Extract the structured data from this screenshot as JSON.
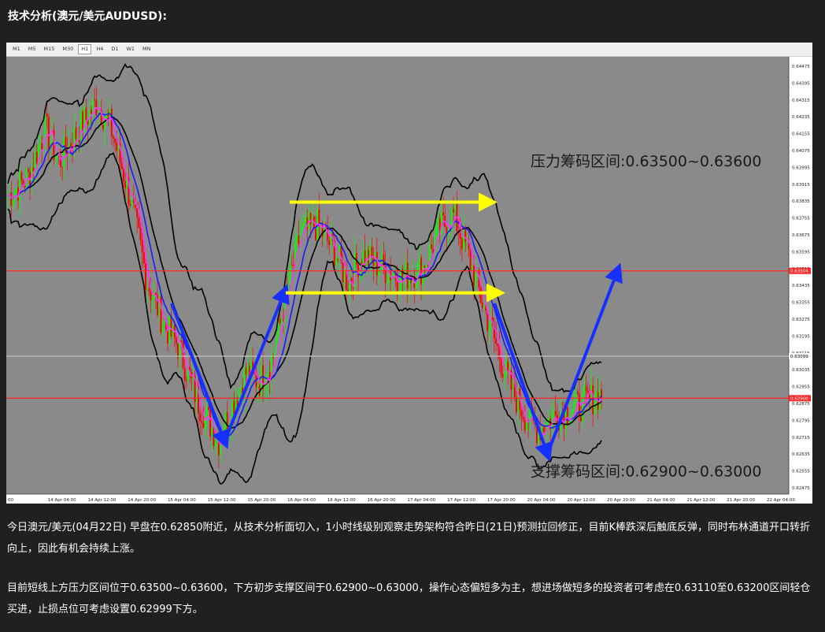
{
  "page": {
    "title": "技术分析(澳元/美元AUDUSD):"
  },
  "timeframes": [
    {
      "label": "M1",
      "active": false
    },
    {
      "label": "M5",
      "active": false
    },
    {
      "label": "M15",
      "active": false
    },
    {
      "label": "M30",
      "active": false
    },
    {
      "label": "H1",
      "active": true
    },
    {
      "label": "H4",
      "active": false
    },
    {
      "label": "D1",
      "active": false
    },
    {
      "label": "W1",
      "active": false
    },
    {
      "label": "MN",
      "active": false
    }
  ],
  "chart_data": {
    "type": "candlestick",
    "symbol": "AUDUSD",
    "timeframe": "H1",
    "ylim": [
      0.62475,
      0.64475
    ],
    "y_ticks": [
      0.64475,
      0.64395,
      0.64315,
      0.64235,
      0.64155,
      0.64075,
      0.63995,
      0.63915,
      0.63835,
      0.63755,
      0.63675,
      0.63595,
      0.63515,
      0.63435,
      0.63355,
      0.63275,
      0.63195,
      0.63115,
      0.63035,
      0.62955,
      0.62875,
      0.62795,
      0.62715,
      0.62635,
      0.62555,
      0.62475
    ],
    "x_labels": [
      "00",
      "14 Apr 04:00",
      "14 Apr 12:00",
      "14 Apr 20:00",
      "15 Apr 04:00",
      "15 Apr 12:00",
      "15 Apr 20:00",
      "16 Apr 04:00",
      "16 Apr 12:00",
      "16 Apr 20:00",
      "17 Apr 04:00",
      "17 Apr 12:00",
      "17 Apr 20:00",
      "20 Apr 04:00",
      "20 Apr 12:00",
      "20 Apr 20:00",
      "21 Apr 04:00",
      "21 Apr 12:00",
      "21 Apr 20:00",
      "22 Apr 04:00"
    ],
    "price_labels": [
      {
        "value": 0.63504,
        "color": "#ff2a2a"
      },
      {
        "value": 0.63099,
        "color": "#ffffff"
      },
      {
        "value": 0.629,
        "color": "#ff2a2a"
      }
    ],
    "horizontal_lines": [
      {
        "value": 0.63504,
        "color": "#ff2a2a"
      },
      {
        "value": 0.629,
        "color": "#ff2a2a"
      },
      {
        "value": 0.63099,
        "color": "#bdbdbd"
      }
    ],
    "annotations": {
      "resistance": "压力筹码区间:0.63500~0.63600",
      "support": "支撑筹码区间:0.62900~0.63000"
    },
    "colors": {
      "background": "#8a8a8a",
      "bull": "#00ff00",
      "bear": "#ff0000",
      "bollinger": "#000000",
      "ma_fast": "#ff33ff",
      "ma_slow": "#1a1aff",
      "arrow_blue": "#1530ff",
      "arrow_yellow": "#ffff00"
    }
  },
  "article": {
    "p1": "今日澳元/美元(04月22日) 早盘在0.62850附近，从技术分析面切入，1小时线级别观察走势架构符合昨日(21日)预测拉回修正，目前K棒跌深后触底反弹，同时布林通道开口转折向上，因此有机会持续上涨。",
    "p2": "目前短线上方压力区间位于0.63500~0.63600，下方初步支撑区间于0.62900~0.63000，操作心态偏短多为主，想进场做短多的投资者可考虑在0.63110至0.63200区间轻仓买进，止损点位可考虑设置0.62999下方。"
  }
}
